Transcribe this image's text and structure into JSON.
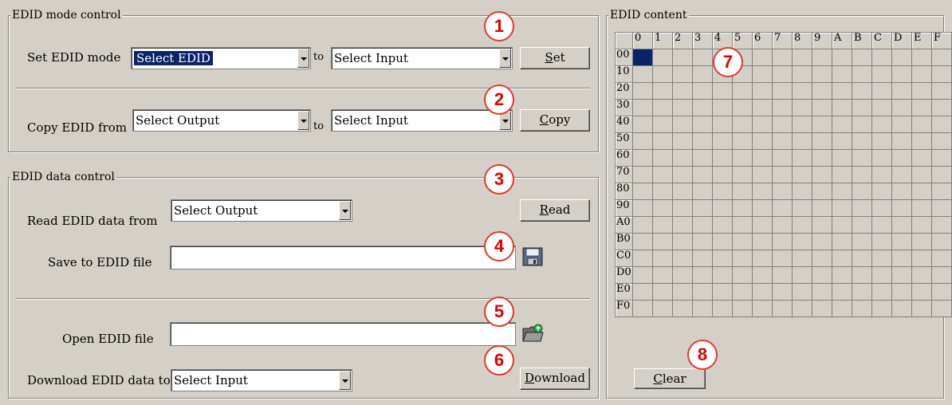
{
  "mode_group": {
    "title": "EDID mode control",
    "set_label": "Set EDID mode",
    "set_combo": "Select EDID",
    "to1": "to",
    "set_input_combo": "Select Input",
    "set_button_key": "S",
    "set_button_rest": "et",
    "copy_label": "Copy EDID from",
    "copy_combo": "Select Output",
    "to2": "to",
    "copy_input_combo": "Select Input",
    "copy_button_key": "C",
    "copy_button_rest": "opy"
  },
  "data_group": {
    "title": "EDID data control",
    "read_label": "Read EDID data from",
    "read_combo": "Select Output",
    "read_button_key": "R",
    "read_button_rest": "ead",
    "save_label": "Save to EDID file",
    "save_value": "",
    "open_label": "Open EDID file",
    "open_value": "",
    "download_label": "Download EDID data to",
    "download_combo": "Select Input",
    "download_button_key": "D",
    "download_button_rest": "ownload"
  },
  "content_group": {
    "title": "EDID content",
    "col_headers": [
      "0",
      "1",
      "2",
      "3",
      "4",
      "5",
      "6",
      "7",
      "8",
      "9",
      "A",
      "B",
      "C",
      "D",
      "E",
      "F"
    ],
    "row_headers": [
      "00",
      "10",
      "20",
      "30",
      "40",
      "50",
      "60",
      "70",
      "80",
      "90",
      "A0",
      "B0",
      "C0",
      "D0",
      "E0",
      "F0"
    ],
    "clear_button_key": "C",
    "clear_button_rest": "lear"
  },
  "markers": [
    "1",
    "2",
    "3",
    "4",
    "5",
    "6",
    "7",
    "8"
  ],
  "colors": {
    "marker_red": "#e00000",
    "selection_blue": "#0a246a",
    "window_gray": "#d4d0c8"
  },
  "icons": {
    "save": "floppy-disk-icon",
    "open": "folder-open-icon"
  }
}
